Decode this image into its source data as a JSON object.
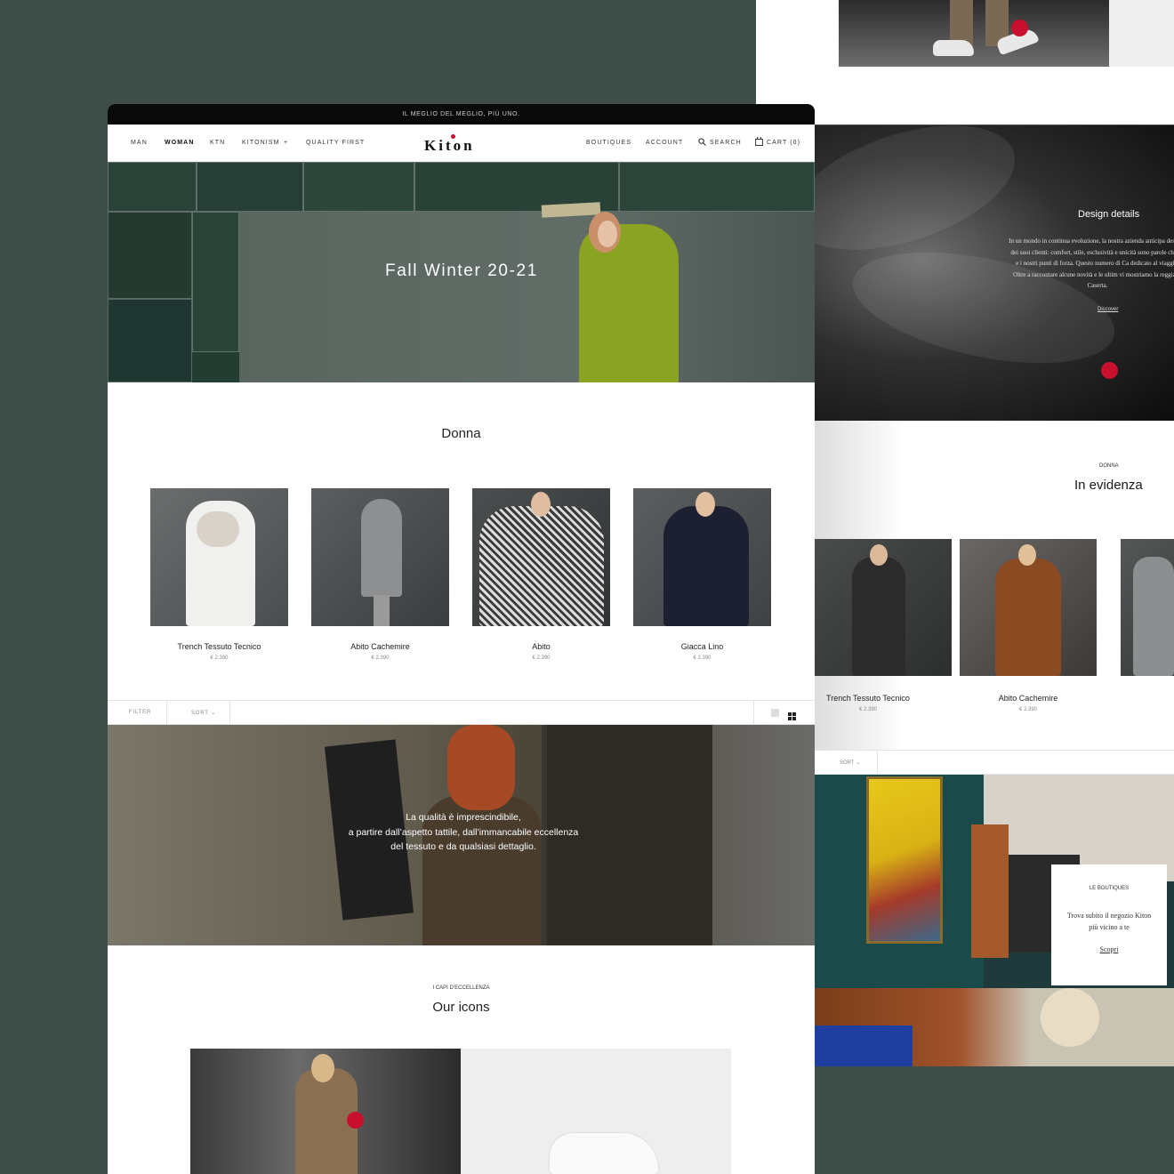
{
  "brand": {
    "logo": "Kiton",
    "accent_color": "#c8102e"
  },
  "topbar": {
    "tagline": "IL MEGLIO DEL MEGLIO, PIÙ UNO."
  },
  "nav": {
    "left": [
      "MAN",
      "WOMAN",
      "KTN",
      "KITONISM",
      "QUALITY FIRST"
    ],
    "kitonism_toggle": "+",
    "active": "WOMAN",
    "right": {
      "boutiques": "BOUTIQUES",
      "account": "ACCOUNT",
      "search": "SEARCH",
      "cart": "CART (0)"
    }
  },
  "hero": {
    "title": "Fall Winter 20-21"
  },
  "donna": {
    "title": "Donna",
    "products": [
      {
        "name": "Trench Tessuto Tecnico",
        "price": "€ 2.390"
      },
      {
        "name": "Abito Cachemire",
        "price": "€ 2.390"
      },
      {
        "name": "Abito",
        "price": "€ 2.390"
      },
      {
        "name": "Giacca Lino",
        "price": "€ 2.390"
      }
    ]
  },
  "filterbar": {
    "filter": "FILTER",
    "sort": "SORT"
  },
  "quality": {
    "lines": [
      "La qualità è imprescindibile,",
      "a partire dall’aspetto tattile, dall’immancabile eccellenza",
      "del tessuto e da qualsiasi dettaglio."
    ]
  },
  "icons": {
    "kicker": "I CAPI D’ECCELLENZA",
    "title": "Our icons"
  },
  "design_details": {
    "title": "Design details",
    "body": "In un mondo in continua evoluzione, la nostra azienda anticipa desideri dei suoi clienti: comfort, stile, esclusività e unicità sono parole chiave e i nostri punti di forza. Questo numero di Ca dedicato al viaggio. Oltre a raccontare alcune novità e le ultim vi mostriamo la reggia di Caserta.",
    "link": "Discover"
  },
  "evidenza": {
    "kicker": "DONNA",
    "title": "In evidenza",
    "products": [
      {
        "name": "Trench Tessuto Tecnico",
        "price": "€ 2.390"
      },
      {
        "name": "Abito Cachemire",
        "price": "€ 2.390"
      }
    ],
    "sort": "SORT"
  },
  "boutiques": {
    "kicker": "LE BOUTIQUES",
    "text_line1": "Trova subito il negozio Kiton",
    "text_line2": "più vicino a te",
    "link": "Scopri"
  }
}
